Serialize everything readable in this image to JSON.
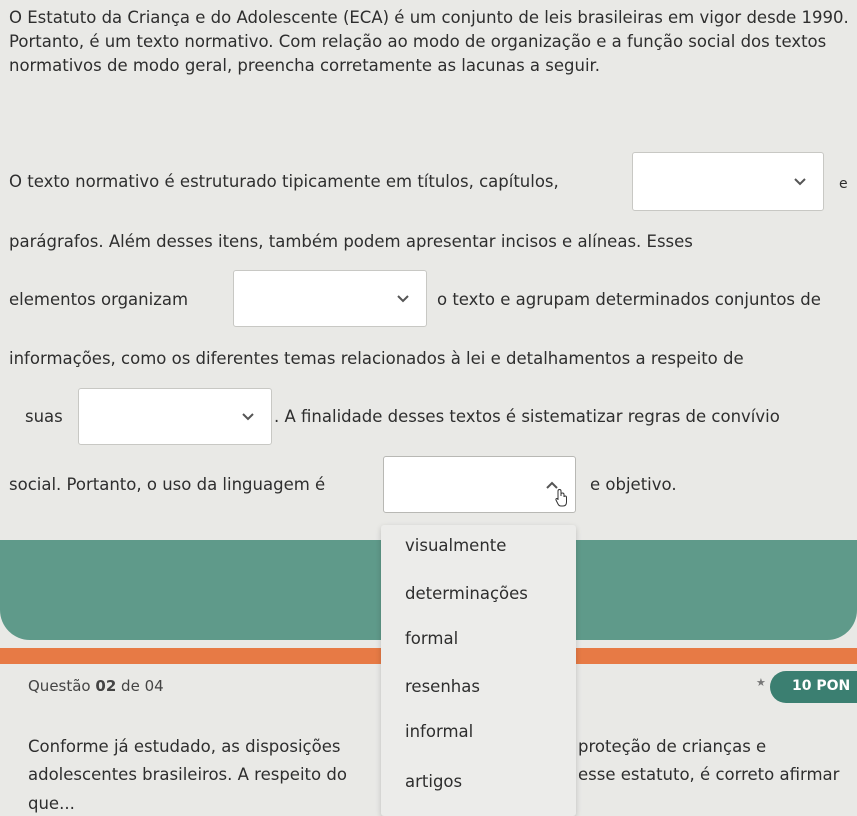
{
  "intro": "O Estatuto da Criança e do Adolescente (ECA) é um conjunto de leis brasileiras em vigor desde 1990. Portanto, é um texto normativo. Com relação ao modo de organização e a função social dos textos normativos de modo geral, preencha corretamente as lacunas a seguir.",
  "passage": {
    "l1a": "O texto normativo é estruturado tipicamente em títulos, capítulos,",
    "l1b": "e",
    "l2": "parágrafos. Além desses itens, também podem apresentar incisos e alíneas. Esses",
    "l3a": "elementos organizam",
    "l3b": "o texto e agrupam determinados conjuntos de",
    "l4": "informações, como os diferentes temas relacionados à lei e detalhamentos a respeito de",
    "l5a": "suas",
    "l5b": ". A finalidade desses textos é sistematizar regras de convívio",
    "l6a": "social. Portanto, o uso da linguagem é",
    "l6b": "e objetivo."
  },
  "dropdown_options": [
    "visualmente",
    "determinações",
    "formal",
    "resenhas",
    "informal",
    "artigos"
  ],
  "question2": {
    "label_prefix": "Questão",
    "number": "02",
    "label_suffix": "de 04",
    "points": "10 PON",
    "line1a": "Conforme já estudado, as disposições",
    "line1b": "proteção de crianças e",
    "line2a": "adolescentes brasileiros. A respeito do",
    "line2b": "esse estatuto, é correto afirmar",
    "line3": "que..."
  },
  "colors": {
    "green": "#5f9a8a",
    "orange": "#e77a45",
    "badge": "#3b7f71"
  }
}
